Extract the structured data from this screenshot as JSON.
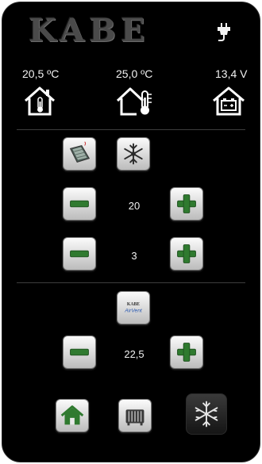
{
  "header": {
    "logo_text": "KABE",
    "power_icon": "plug-icon"
  },
  "status": {
    "indoor_temp": "20,5 ºC",
    "set_temp": "25,0 ºC",
    "battery_voltage": "13,4 V"
  },
  "heating": {
    "setpoint_value": "20",
    "second_value": "3"
  },
  "airvent": {
    "brand_text": "KABE",
    "product_text": "AirVent",
    "value": "22,5"
  },
  "colors": {
    "background": "#000000",
    "text": "#f2f2f2",
    "button_green": "#2f7a2f",
    "divider": "#3d3d3d"
  },
  "icons": {
    "heater_panel": "floor-heating-icon",
    "climate_top": "snowflake-icon",
    "minus": "minus-icon",
    "plus": "plus-icon",
    "home": "home-icon",
    "radiator": "radiator-icon",
    "climate_bottom": "snowflake-icon"
  }
}
